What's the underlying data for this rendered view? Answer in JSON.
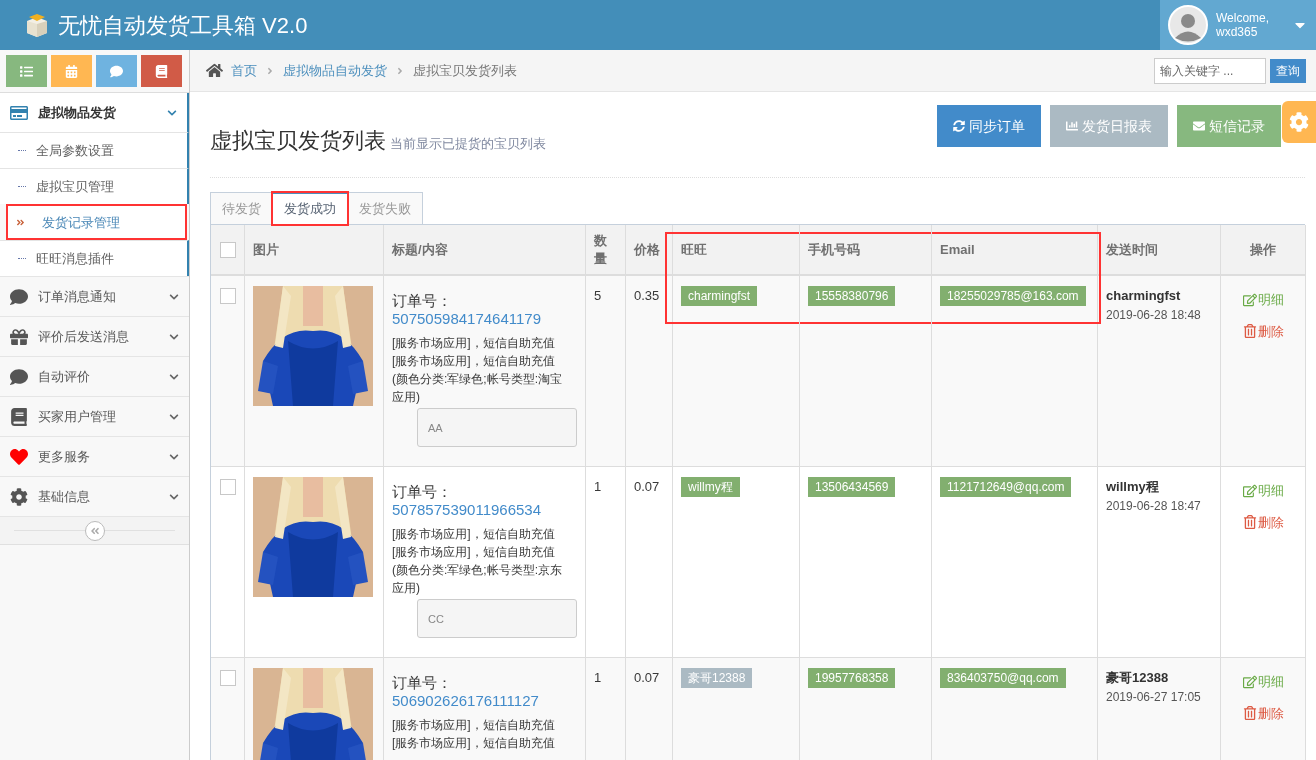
{
  "app": {
    "title": "无忧自动发货工具箱 V2.0"
  },
  "user": {
    "greeting": "Welcome,",
    "name": "wxd365"
  },
  "sidebar": {
    "items": [
      {
        "label": "虚拟物品发货",
        "expanded": true,
        "children": [
          {
            "label": "全局参数设置",
            "selected": false,
            "highlighted": false
          },
          {
            "label": "虚拟宝贝管理",
            "selected": false,
            "highlighted": false
          },
          {
            "label": "发货记录管理",
            "selected": true,
            "highlighted": true
          },
          {
            "label": "旺旺消息插件",
            "selected": false,
            "highlighted": false
          }
        ]
      },
      {
        "label": "订单消息通知",
        "expanded": false
      },
      {
        "label": "评价后发送消息",
        "expanded": false
      },
      {
        "label": "自动评价",
        "expanded": false
      },
      {
        "label": "买家用户管理",
        "expanded": false
      },
      {
        "label": "更多服务",
        "expanded": false
      },
      {
        "label": "基础信息",
        "expanded": false
      }
    ]
  },
  "breadcrumb": [
    "首页",
    "虚拟物品自动发货",
    "虚拟宝贝发货列表"
  ],
  "search": {
    "placeholder": "输入关键字 ...",
    "button": "查询"
  },
  "page": {
    "title": "虚拟宝贝发货列表",
    "subtitle": "当前显示已提货的宝贝列表"
  },
  "actions": [
    {
      "label": "同步订单",
      "kind": "sync"
    },
    {
      "label": "发货日报表",
      "kind": "report"
    },
    {
      "label": "短信记录",
      "kind": "sms"
    }
  ],
  "tabs": [
    {
      "label": "待发货",
      "selected": false,
      "highlighted": false
    },
    {
      "label": "发货成功",
      "selected": true,
      "highlighted": true
    },
    {
      "label": "发货失败",
      "selected": false,
      "highlighted": false
    }
  ],
  "table": {
    "select_all": {
      "checked": false
    },
    "columns": [
      {
        "label": "图片",
        "highlighted": false
      },
      {
        "label": "标题/内容",
        "highlighted": false
      },
      {
        "label": "数量",
        "highlighted": false
      },
      {
        "label": "价格",
        "highlighted": false
      },
      {
        "label": "旺旺",
        "highlighted": true
      },
      {
        "label": "手机号码",
        "highlighted": true
      },
      {
        "label": "Email",
        "highlighted": true
      },
      {
        "label": "发送时间",
        "highlighted": false
      },
      {
        "label": "操作",
        "highlighted": false
      }
    ],
    "rows": [
      {
        "checked": false,
        "order_label": "订单号：",
        "order_no": "507505984174641179",
        "description": [
          "[服务市场应用]，短信自助充值",
          "[服务市场应用]，短信自助充值",
          "(颜色分类:军绿色;帐号类型:淘宝",
          "应用)"
        ],
        "note": "AA",
        "quantity": "5",
        "price": "0.35",
        "wangwang": {
          "text": "charmingfst",
          "color": "#82af6f"
        },
        "phone": "15558380796",
        "email": "18255029785@163.com",
        "sender": "charmingfst",
        "time": "2019-06-28 18:48",
        "actions": [
          {
            "label": "明细",
            "kind": "detail"
          },
          {
            "label": "删除",
            "kind": "delete"
          }
        ]
      },
      {
        "checked": false,
        "order_label": "订单号：",
        "order_no": "507857539011966534",
        "description": [
          "[服务市场应用]，短信自助充值",
          "[服务市场应用]，短信自助充值",
          "(颜色分类:军绿色;帐号类型:京东",
          "应用)"
        ],
        "note": "CC",
        "quantity": "1",
        "price": "0.07",
        "wangwang": {
          "text": "willmy程",
          "color": "#82af6f"
        },
        "phone": "13506434569",
        "email": "1121712649@qq.com",
        "sender": "willmy程",
        "time": "2019-06-28 18:47",
        "actions": [
          {
            "label": "明细",
            "kind": "detail"
          },
          {
            "label": "删除",
            "kind": "delete"
          }
        ]
      },
      {
        "checked": false,
        "order_label": "订单号：",
        "order_no": "506902626176111127",
        "description": [
          "[服务市场应用]，短信自助充值",
          "[服务市场应用]，短信自助充值"
        ],
        "quantity": "1",
        "price": "0.07",
        "wangwang": {
          "text": "豪哥12388",
          "color": "#abbac3"
        },
        "phone": "19957768358",
        "email": "836403750@qq.com",
        "sender": "豪哥12388",
        "time": "2019-06-27 17:05",
        "actions": [
          {
            "label": "明细",
            "kind": "detail"
          },
          {
            "label": "删除",
            "kind": "delete"
          }
        ]
      }
    ]
  }
}
